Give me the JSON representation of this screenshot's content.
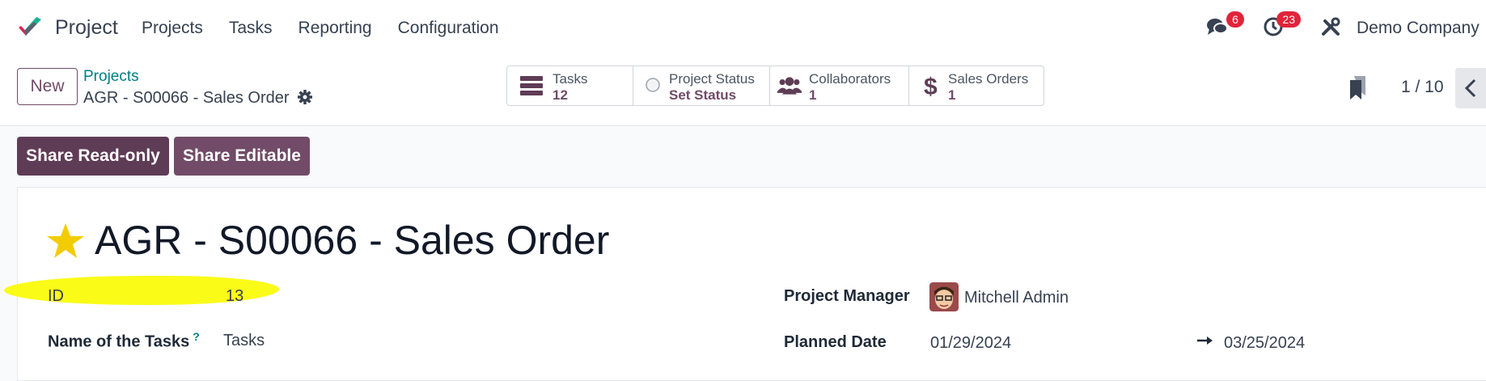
{
  "navbar": {
    "app_name": "Project",
    "menu": [
      "Projects",
      "Tasks",
      "Reporting",
      "Configuration"
    ],
    "messages_count": "6",
    "activities_count": "23",
    "company": "Demo Company"
  },
  "control_panel": {
    "new_label": "New",
    "breadcrumb_parent": "Projects",
    "breadcrumb_current": "AGR - S00066 - Sales Order",
    "stats": [
      {
        "label": "Tasks",
        "value": "12",
        "icon": "tasks-icon"
      },
      {
        "label": "Project Status",
        "value": "Set Status",
        "icon": "status-circle-icon"
      },
      {
        "label": "Collaborators",
        "value": "1",
        "icon": "users-icon"
      },
      {
        "label": "Sales Orders",
        "value": "1",
        "icon": "dollar-icon"
      }
    ],
    "pager": "1 / 10"
  },
  "actions": {
    "share_readonly": "Share Read-only",
    "share_editable": "Share Editable"
  },
  "form": {
    "title": "AGR - S00066 - Sales Order",
    "id_label": "ID",
    "id_value": "13",
    "tasks_name_label": "Name of the Tasks",
    "tasks_name_help": "?",
    "tasks_name_value": "Tasks",
    "manager_label": "Project Manager",
    "manager_value": "Mitchell Admin",
    "planned_label": "Planned Date",
    "planned_start": "01/29/2024",
    "planned_end": "03/25/2024"
  },
  "colors": {
    "brand": "#714b67",
    "brand_dark": "#5f3c56",
    "link": "#017e84",
    "badge": "#e0243a",
    "star": "#f3cc00",
    "highlight": "#fbfb18"
  }
}
